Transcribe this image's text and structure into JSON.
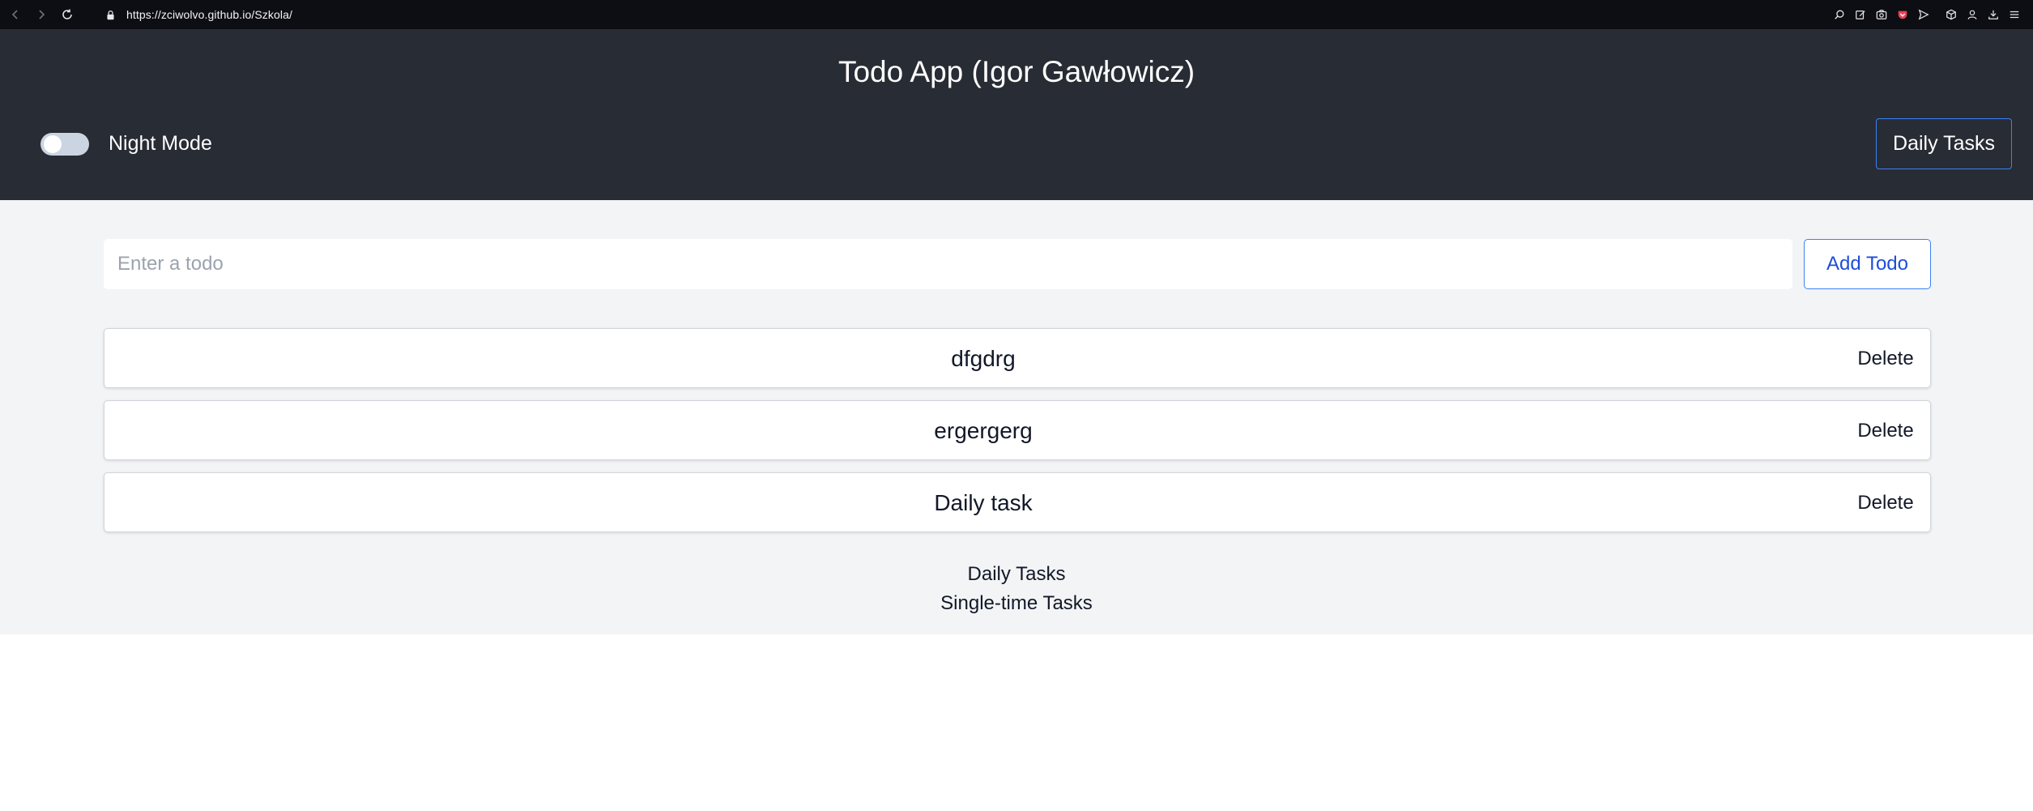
{
  "browser": {
    "url": "https://zciwolvo.github.io/Szkola/",
    "icons": [
      "back-icon",
      "forward-icon",
      "reload-icon",
      "lock-icon",
      "zoom-icon",
      "edit-icon",
      "screenshot-icon",
      "pocket-icon",
      "send-icon",
      "extensions-icon",
      "account-icon",
      "download-icon",
      "menu-icon"
    ]
  },
  "header": {
    "title": "Todo App (Igor Gawłowicz)",
    "night_mode_label": "Night Mode",
    "night_mode_on": false,
    "daily_tasks_button": "Daily Tasks"
  },
  "form": {
    "input_placeholder": "Enter a todo",
    "input_value": "",
    "add_button": "Add Todo"
  },
  "todos": [
    {
      "text": "dfgdrg",
      "delete_label": "Delete"
    },
    {
      "text": "ergergerg",
      "delete_label": "Delete"
    },
    {
      "text": "Daily task",
      "delete_label": "Delete"
    }
  ],
  "footer": {
    "links": [
      "Daily Tasks",
      "Single-time Tasks"
    ]
  },
  "colors": {
    "header_bg": "#282c34",
    "main_bg": "#f3f4f6",
    "accent": "#3b82f6",
    "add_button_text": "#1d4ed8"
  }
}
